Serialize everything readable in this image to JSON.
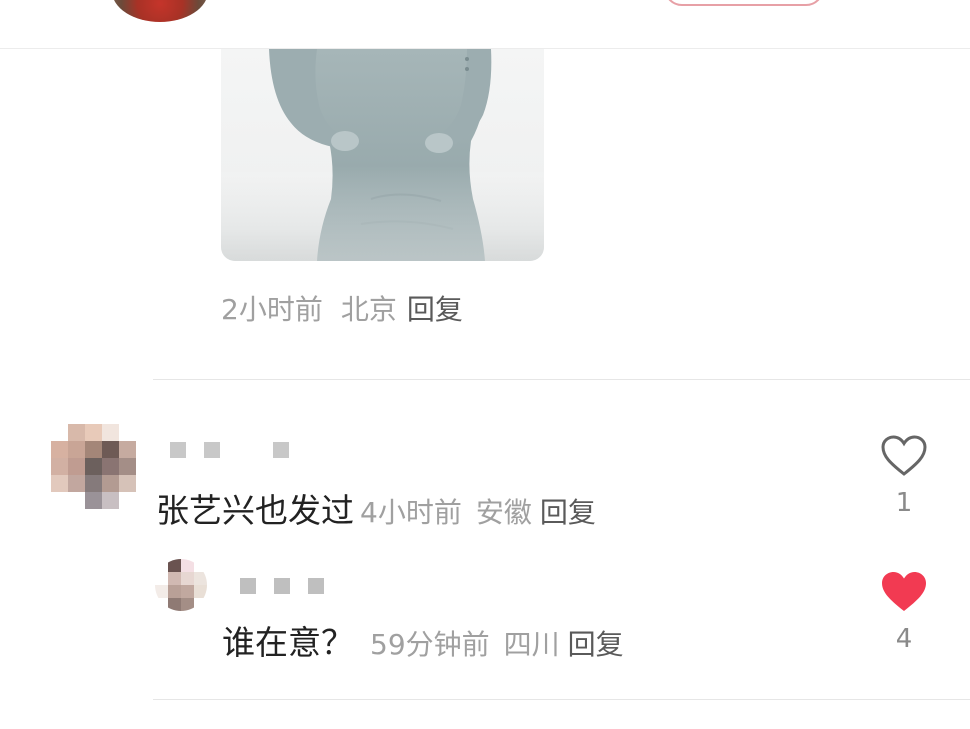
{
  "colors": {
    "meta_gray": "#a0a0a0",
    "reply_gray": "#5a5a5a",
    "liked_red": "#f23a52",
    "divider": "#e6e6e6"
  },
  "prev_comment": {
    "time": "2小时前",
    "location": "北京",
    "reply": "回复"
  },
  "comments": [
    {
      "text": "张艺兴也发过",
      "time": "4小时前",
      "location": "安徽",
      "reply": "回复",
      "like_icon": "heart-outline-icon",
      "likes": "1",
      "liked": false
    },
    {
      "text": "谁在意？",
      "time": "59分钟前",
      "location": "四川",
      "reply": "回复",
      "like_icon": "heart-filled-icon",
      "likes": "4",
      "liked": true
    }
  ]
}
